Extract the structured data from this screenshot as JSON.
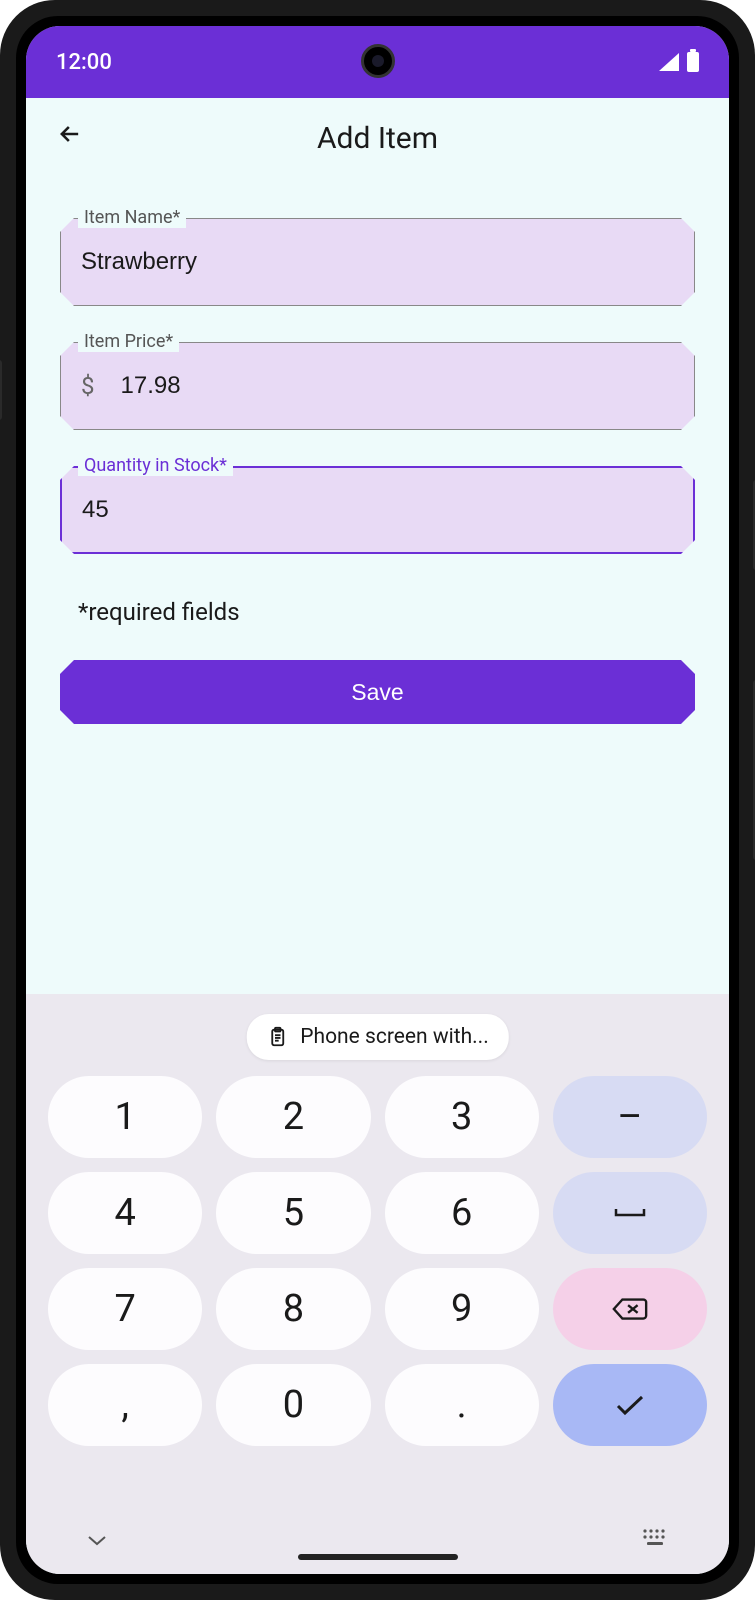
{
  "status": {
    "time": "12:00"
  },
  "appbar": {
    "title": "Add Item"
  },
  "form": {
    "name": {
      "label": "Item Name*",
      "value": "Strawberry"
    },
    "price": {
      "label": "Item Price*",
      "prefix": "$",
      "value": "17.98"
    },
    "qty": {
      "label": "Quantity in Stock*",
      "value": "45"
    },
    "required_note": "*required fields",
    "save_label": "Save"
  },
  "clipboard": {
    "text": "Phone screen with..."
  },
  "keypad": {
    "rows": [
      [
        "1",
        "2",
        "3",
        "-"
      ],
      [
        "4",
        "5",
        "6",
        "␣"
      ],
      [
        "7",
        "8",
        "9",
        "⌫"
      ],
      [
        ",",
        "0",
        ".",
        "✓"
      ]
    ],
    "k1": "1",
    "k2": "2",
    "k3": "3",
    "kdash": "–",
    "k4": "4",
    "k5": "5",
    "k6": "6",
    "k7": "7",
    "k8": "8",
    "k9": "9",
    "kcomma": ",",
    "k0": "0",
    "kdot": "."
  }
}
